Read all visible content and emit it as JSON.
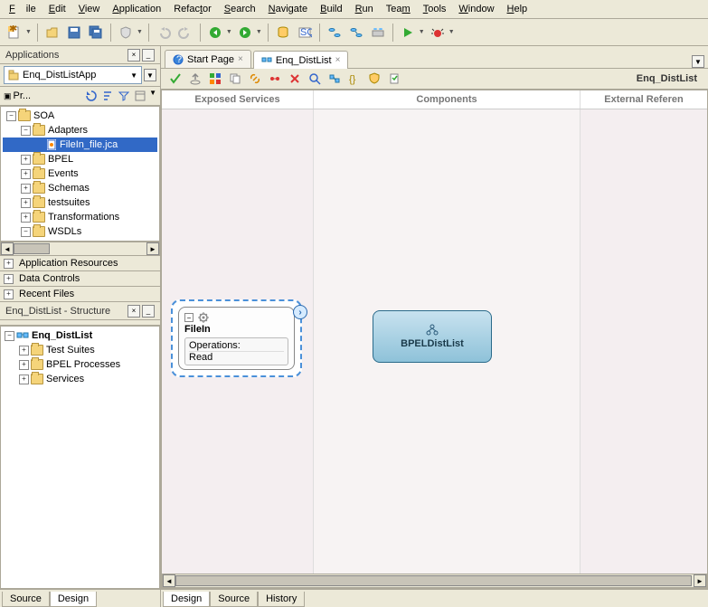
{
  "menu": {
    "file": "File",
    "edit": "Edit",
    "view": "View",
    "application": "Application",
    "refactor": "Refactor",
    "search": "Search",
    "navigate": "Navigate",
    "build": "Build",
    "run": "Run",
    "team": "Team",
    "tools": "Tools",
    "window": "Window",
    "help": "Help"
  },
  "appPanel": {
    "title": "Applications",
    "selector": "Enq_DistListApp",
    "projectsLabel": "Pr...",
    "tree": {
      "root": "SOA",
      "adapters": "Adapters",
      "file": "FileIn_file.jca",
      "bpel": "BPEL",
      "events": "Events",
      "schemas": "Schemas",
      "testsuites": "testsuites",
      "transformations": "Transformations",
      "wsdls": "WSDLs"
    },
    "appResources": "Application Resources",
    "dataControls": "Data Controls",
    "recentFiles": "Recent Files"
  },
  "structurePanel": {
    "title": "Enq_DistList - Structure",
    "root": "Enq_DistList",
    "testSuites": "Test Suites",
    "bpelProcesses": "BPEL Processes",
    "services": "Services"
  },
  "leftBottomTabs": {
    "source": "Source",
    "design": "Design"
  },
  "editor": {
    "tabs": {
      "start": "Start Page",
      "main": "Enq_DistList"
    },
    "title": "Enq_DistList",
    "lanes": {
      "exposed": "Exposed Services",
      "components": "Components",
      "external": "External Referen"
    },
    "fileComp": {
      "name": "FileIn",
      "ops": "Operations:",
      "read": "Read"
    },
    "bpelComp": {
      "name": "BPELDistList"
    },
    "bottomTabs": {
      "design": "Design",
      "source": "Source",
      "history": "History"
    }
  },
  "icons": {
    "new": "new-icon",
    "open": "open-icon",
    "save": "save-icon",
    "saveall": "saveall-icon",
    "shield": "shield-icon",
    "undo": "undo-icon",
    "redo": "redo-icon",
    "back": "back-icon",
    "fwd": "fwd-icon",
    "db": "db-icon",
    "sql": "sql-icon",
    "grp1": "grp1-icon",
    "grp2": "grp2-icon",
    "grp3": "grp3-icon",
    "run": "run-icon",
    "debug": "debug-icon"
  }
}
